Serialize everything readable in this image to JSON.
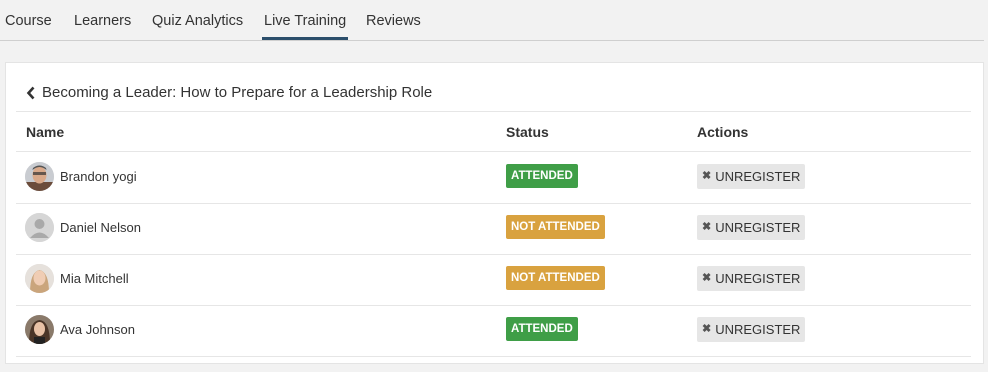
{
  "tabs": [
    {
      "label": "Course"
    },
    {
      "label": "Learners"
    },
    {
      "label": "Quiz Analytics"
    },
    {
      "label": "Live Training",
      "active": true
    },
    {
      "label": "Reviews"
    }
  ],
  "colors": {
    "accent": "#2b4e6b",
    "attended": "#3f9e47",
    "not_attended": "#d9a23f",
    "button_bg": "#e6e6e6"
  },
  "page": {
    "title": "Becoming a Leader: How to Prepare for a Leadership Role",
    "back_icon": "chevron-left-icon"
  },
  "table": {
    "headers": {
      "name": "Name",
      "status": "Status",
      "actions": "Actions"
    },
    "rows": [
      {
        "name": "Brandon yogi",
        "status": "ATTENDED",
        "status_color": "#3f9e47",
        "action": "UNREGISTER",
        "avatar": "photo"
      },
      {
        "name": "Daniel Nelson",
        "status": "NOT ATTENDED",
        "status_color": "#d9a23f",
        "action": "UNREGISTER",
        "avatar": "placeholder"
      },
      {
        "name": "Mia Mitchell",
        "status": "NOT ATTENDED",
        "status_color": "#d9a23f",
        "action": "UNREGISTER",
        "avatar": "photo"
      },
      {
        "name": "Ava Johnson",
        "status": "ATTENDED",
        "status_color": "#3f9e47",
        "action": "UNREGISTER",
        "avatar": "photo"
      }
    ]
  }
}
